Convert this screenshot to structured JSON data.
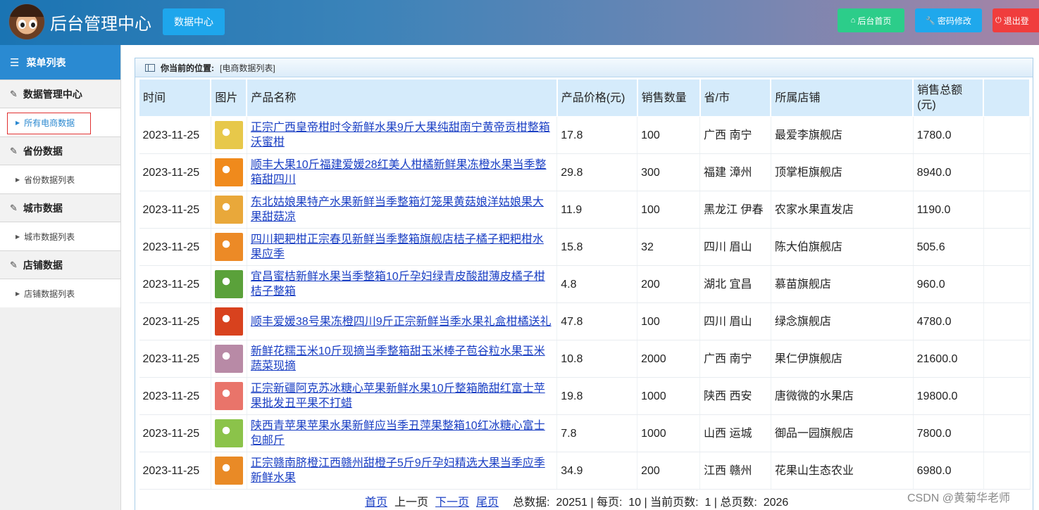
{
  "header": {
    "app_title": "后台管理中心",
    "data_center_label": "数据中心",
    "home_label": "后台首页",
    "password_label": "密码修改",
    "exit_label": "退出登"
  },
  "sidebar": {
    "menu_title": "菜单列表",
    "groups": [
      {
        "label": "数据管理中心",
        "item": "所有电商数据"
      },
      {
        "label": "省份数据",
        "item": "省份数据列表"
      },
      {
        "label": "城市数据",
        "item": "城市数据列表"
      },
      {
        "label": "店铺数据",
        "item": "店铺数据列表"
      }
    ]
  },
  "breadcrumb": {
    "label": "你当前的位置:",
    "value": "[电商数据列表]"
  },
  "table": {
    "headers": [
      "时间",
      "图片",
      "产品名称",
      "产品价格(元)",
      "销售数量",
      "省/市",
      "所属店铺",
      "销售总额(元)"
    ],
    "rows": [
      {
        "time": "2023-11-25",
        "name": "正宗广西皇帝柑时令新鲜水果9斤大果纯甜南宁黄帝贡柑整箱沃蜜柑",
        "price": "17.8",
        "qty": "100",
        "region": "广西 南宁",
        "shop": "最爱李旗舰店",
        "total": "1780.0",
        "thumb": "#e7c84a"
      },
      {
        "time": "2023-11-25",
        "name": "顺丰大果10斤福建爱媛28红美人柑橘新鲜果冻橙水果当季整箱甜四川",
        "price": "29.8",
        "qty": "300",
        "region": "福建 漳州",
        "shop": "顶掌柜旗舰店",
        "total": "8940.0",
        "thumb": "#f08a1c"
      },
      {
        "time": "2023-11-25",
        "name": "东北姑娘果特产水果新鲜当季整箱灯笼果黄菇娘洋姑娘果大果甜菇凉",
        "price": "11.9",
        "qty": "100",
        "region": "黑龙江 伊春",
        "shop": "农家水果直发店",
        "total": "1190.0",
        "thumb": "#e9a83a"
      },
      {
        "time": "2023-11-25",
        "name": "四川耙耙柑正宗春见新鲜当季整箱旗舰店桔子橘子粑粑柑水果应季",
        "price": "15.8",
        "qty": "32",
        "region": "四川 眉山",
        "shop": "陈大伯旗舰店",
        "total": "505.6",
        "thumb": "#ec8a26"
      },
      {
        "time": "2023-11-25",
        "name": "宜昌蜜桔新鲜水果当季整箱10斤孕妇绿青皮酸甜薄皮橘子柑桔子整箱",
        "price": "4.8",
        "qty": "200",
        "region": "湖北 宜昌",
        "shop": "慕苗旗舰店",
        "total": "960.0",
        "thumb": "#5aa13a"
      },
      {
        "time": "2023-11-25",
        "name": "顺丰爱媛38号果冻橙四川9斤正宗新鲜当季水果礼盒柑橘送礼",
        "price": "47.8",
        "qty": "100",
        "region": "四川 眉山",
        "shop": "绿念旗舰店",
        "total": "4780.0",
        "thumb": "#d8421e"
      },
      {
        "time": "2023-11-25",
        "name": "新鲜花糯玉米10斤现摘当季整箱甜玉米棒子苞谷粒水果玉米蔬菜现摘",
        "price": "10.8",
        "qty": "2000",
        "region": "广西 南宁",
        "shop": "果仁伊旗舰店",
        "total": "21600.0",
        "thumb": "#b88aa6"
      },
      {
        "time": "2023-11-25",
        "name": "正宗新疆阿克苏冰糖心苹果新鲜水果10斤整箱脆甜红富士苹果批发丑平果不打蜡",
        "price": "19.8",
        "qty": "1000",
        "region": "陕西 西安",
        "shop": "唐微微的水果店",
        "total": "19800.0",
        "thumb": "#e9746a"
      },
      {
        "time": "2023-11-25",
        "name": "陕西青苹果苹果水果新鲜应当季丑萍果整箱10红冰糖心富士包邮斤",
        "price": "7.8",
        "qty": "1000",
        "region": "山西 运城",
        "shop": "御品一园旗舰店",
        "total": "7800.0",
        "thumb": "#8bc34a"
      },
      {
        "time": "2023-11-25",
        "name": "正宗赣南脐橙江西赣州甜橙子5斤9斤孕妇精选大果当季应季新鲜水果",
        "price": "34.9",
        "qty": "200",
        "region": "江西 赣州",
        "shop": "花果山生态农业",
        "total": "6980.0",
        "thumb": "#e98a26"
      }
    ]
  },
  "pager": {
    "first": "首页",
    "prev": "上一页",
    "next": "下一页",
    "last": "尾页",
    "summary": "总数据:  20251 | 每页:  10 | 当前页数:  1 | 总页数:  2026"
  },
  "watermark": "CSDN @黄菊华老师"
}
